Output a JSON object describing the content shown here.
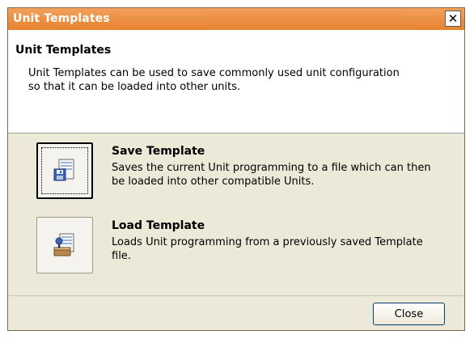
{
  "window": {
    "title": "Unit Templates",
    "close_glyph": "✕"
  },
  "header": {
    "title": "Unit Templates",
    "description": "Unit Templates can be used to save commonly used unit configuration so that it can be loaded into other units."
  },
  "options": [
    {
      "title": "Save Template",
      "description": "Saves the current Unit programming to a file which can then be loaded into other compatible Units.",
      "icon": "save-template-icon"
    },
    {
      "title": "Load Template",
      "description": "Loads Unit programming from a previously saved Template file.",
      "icon": "load-template-icon"
    }
  ],
  "footer": {
    "close_label": "Close"
  },
  "colors": {
    "titlebar": "#e6822e",
    "dialog_bg": "#ece9d8",
    "header_bg": "#ffffff"
  }
}
